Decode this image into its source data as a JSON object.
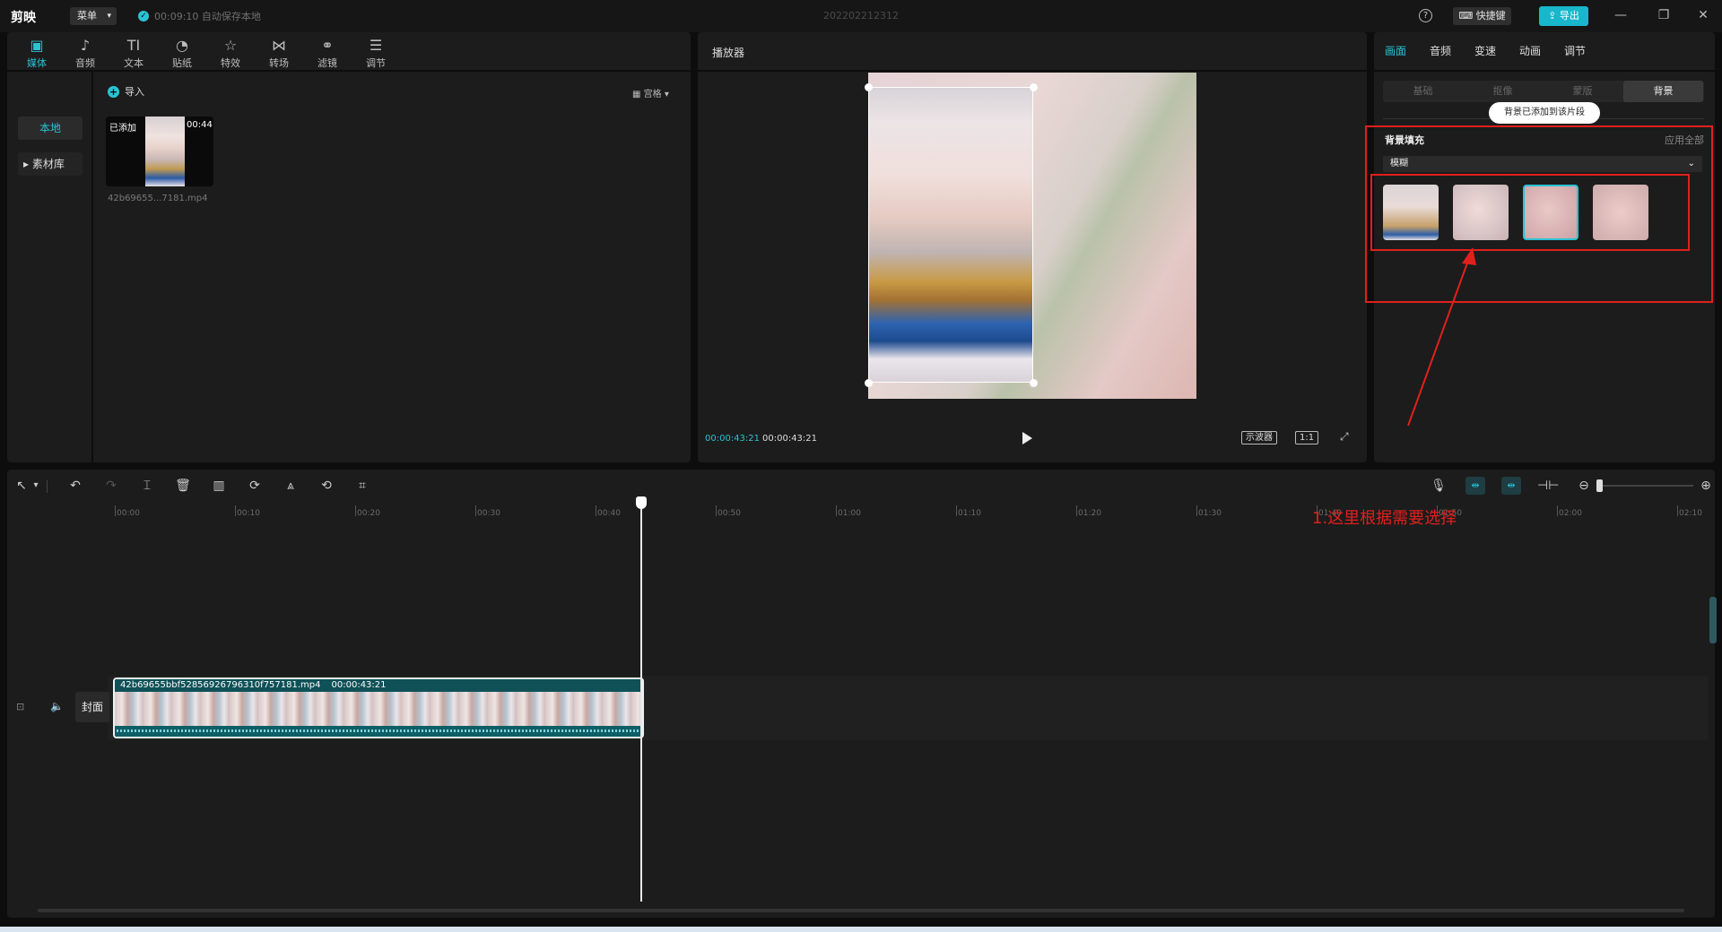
{
  "app": {
    "name": "剪映",
    "menu_label": "菜单",
    "save_status": "00:09:10 自动保存本地",
    "project_title": "202202212312",
    "shortcut_label": "快捷键",
    "export_label": "导出"
  },
  "toolbar": {
    "tabs": [
      {
        "label": "媒体",
        "icon": "media-icon"
      },
      {
        "label": "音频",
        "icon": "audio-icon"
      },
      {
        "label": "文本",
        "icon": "text-icon"
      },
      {
        "label": "贴纸",
        "icon": "sticker-icon"
      },
      {
        "label": "特效",
        "icon": "effects-icon"
      },
      {
        "label": "转场",
        "icon": "transition-icon"
      },
      {
        "label": "滤镜",
        "icon": "filter-icon"
      },
      {
        "label": "调节",
        "icon": "adjust-icon"
      }
    ],
    "active_tab": "媒体"
  },
  "media": {
    "nav": [
      "本地",
      "素材库"
    ],
    "import_label": "导入",
    "view_mode": "宫格",
    "clip": {
      "added_badge": "已添加",
      "duration": "00:44",
      "filename": "42b69655...7181.mp4"
    }
  },
  "player": {
    "title": "播放器",
    "current_time": "00:00:43:21",
    "total_time": "00:00:43:21",
    "scope_label": "示波器",
    "ratio_label": "1:1"
  },
  "properties": {
    "tabs": [
      "画面",
      "音频",
      "变速",
      "动画",
      "调节"
    ],
    "active_tab": "画面",
    "subtabs": [
      "基础",
      "抠像",
      "蒙版",
      "背景"
    ],
    "active_subtab": "背景",
    "tooltip": "背景已添加到该片段",
    "bg_fill_label": "背景填充",
    "apply_all": "应用全部",
    "fill_mode": "模糊",
    "blur_options_count": 4,
    "selected_option": 3
  },
  "timeline": {
    "ticks": [
      "00:00",
      "00:10",
      "00:20",
      "00:30",
      "00:40",
      "00:50",
      "01:00",
      "01:10",
      "01:20",
      "01:30",
      "01:40",
      "01:50",
      "02:00",
      "02:10"
    ],
    "cover_label": "封面",
    "clip_name": "42b69655bbf52856926796310f757181.mp4",
    "clip_duration": "00:00:43:21"
  },
  "annotation": {
    "text": "1.这里根据需要选择",
    "color": "#e0201c"
  },
  "colors": {
    "accent": "#2ac3d4",
    "annotation_red": "#e0201c"
  }
}
